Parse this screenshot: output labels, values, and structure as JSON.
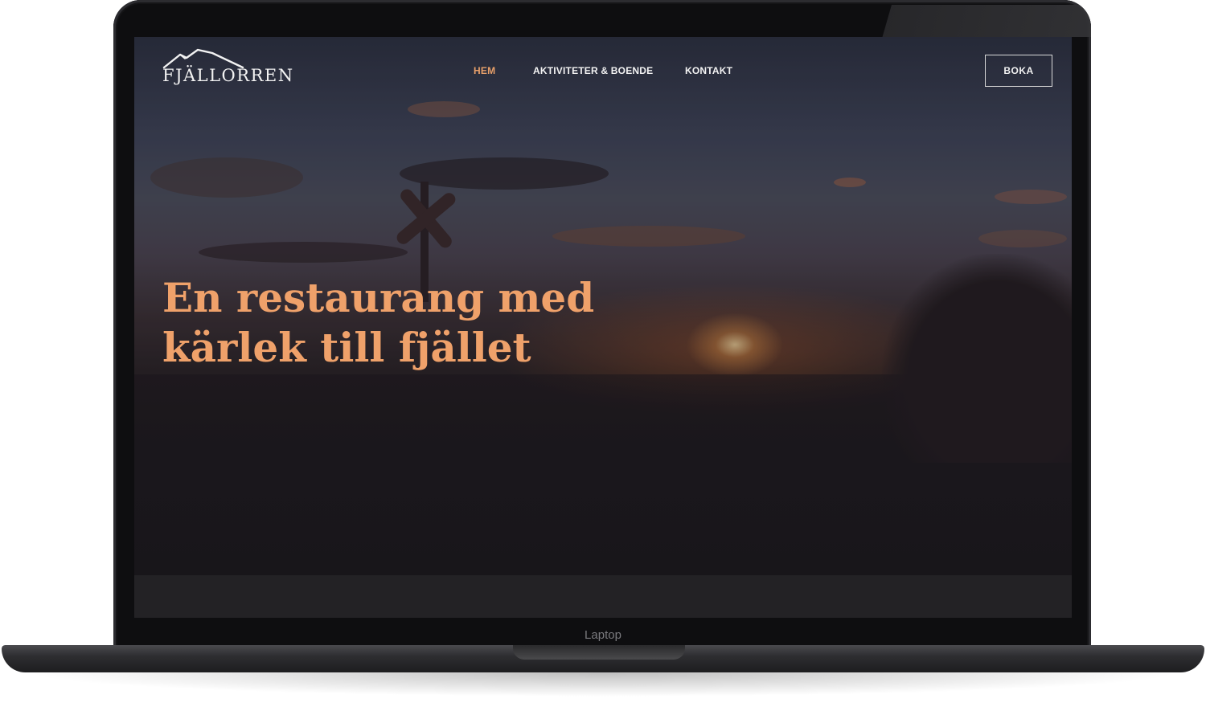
{
  "device": {
    "label": "Laptop"
  },
  "site": {
    "logo_text": "FJÄLLORREN",
    "nav": [
      {
        "label": "HEM",
        "active": true
      },
      {
        "label": "AKTIVITETER & BOENDE",
        "active": false
      },
      {
        "label": "KONTAKT",
        "active": false
      }
    ],
    "book_label": "BOKA",
    "hero": {
      "headline_line1": "En restaurang med",
      "headline_line2": "kärlek till fjället"
    }
  },
  "colors": {
    "accent": "#efa16a",
    "nav_active": "#e8a06a",
    "text_light": "#f2f2f2",
    "screen_bg": "#1f1d22"
  }
}
